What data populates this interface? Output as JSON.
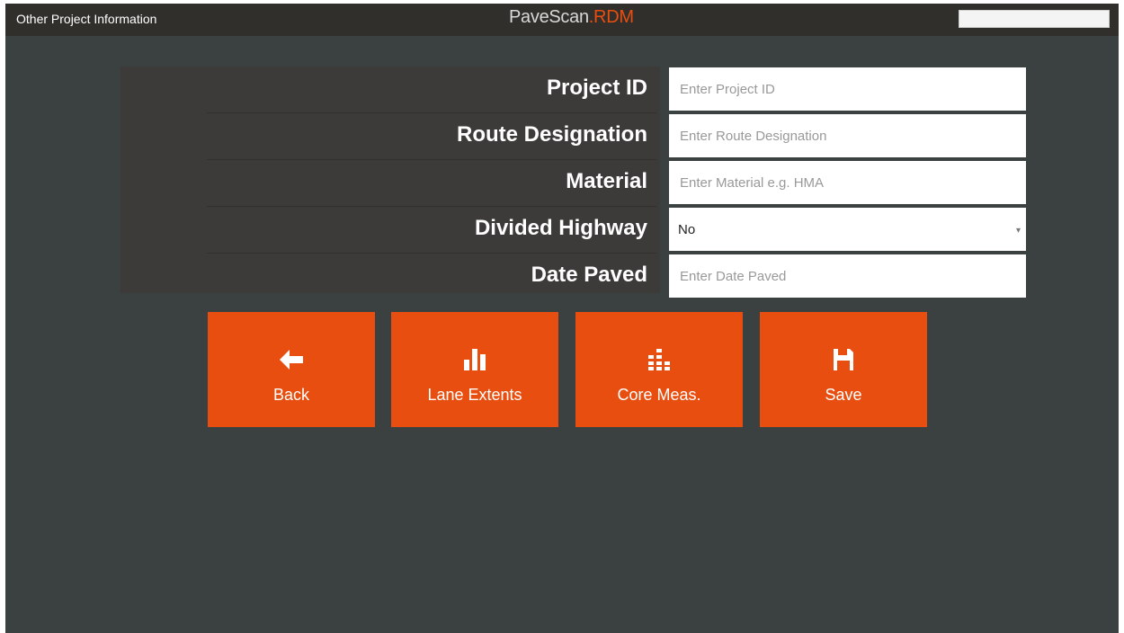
{
  "window": {
    "title": "Other Project Information"
  },
  "brand": {
    "name": "PaveScan",
    "separator": ".",
    "suffix": "RDM"
  },
  "form": {
    "fields": [
      {
        "label": "Project ID",
        "placeholder": "Enter Project ID",
        "value": ""
      },
      {
        "label": "Route Designation",
        "placeholder": "Enter Route Designation",
        "value": ""
      },
      {
        "label": "Material",
        "placeholder": "Enter Material e.g. HMA",
        "value": ""
      },
      {
        "label": "Divided Highway",
        "type": "select",
        "value": "No"
      },
      {
        "label": "Date Paved",
        "placeholder": "Enter Date Paved",
        "value": ""
      }
    ]
  },
  "buttons": [
    {
      "label": "Back",
      "icon": "arrow-left-icon"
    },
    {
      "label": "Lane Extents",
      "icon": "bar-chart-icon"
    },
    {
      "label": "Core Meas.",
      "icon": "core-grid-icon"
    },
    {
      "label": "Save",
      "icon": "floppy-disk-icon"
    }
  ],
  "colors": {
    "accent": "#e84e0f",
    "background": "#3b4040",
    "topbar": "#302f2b"
  }
}
